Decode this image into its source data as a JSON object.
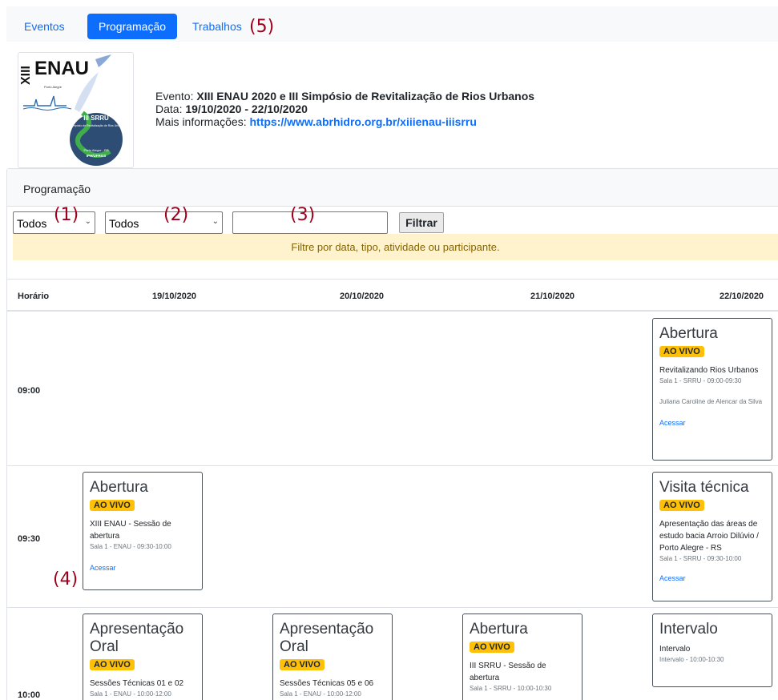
{
  "tabs": [
    {
      "label": "Eventos"
    },
    {
      "label": "Programação"
    },
    {
      "label": "Trabalhos"
    }
  ],
  "annotations": [
    "(1)",
    "(2)",
    "(3)",
    "(4)",
    "(5)"
  ],
  "event": {
    "name_label": "Evento:",
    "name": "XIII ENAU 2020 e III Simpósio de Revitalização de Rios Urbanos",
    "date_label": "Data:",
    "date": "19/10/2020 - 22/10/2020",
    "info_label": "Mais informações:",
    "info_link": "https://www.abrhidro.org.br/xiiienau-iiisrru",
    "logo_text": {
      "main": "ENAU",
      "roman": "XIII",
      "city": "Porto Alegre",
      "badge": "III SRRU",
      "badge_sub": "III Simpósio de Revitalização de Rios Urbanos",
      "place": "Porto Alegre - RS",
      "inst": "IPH/UFRGS"
    }
  },
  "programacao": {
    "header": "Programação",
    "filter_date": "Todos",
    "filter_type": "Todos",
    "search_value": "",
    "filter_button": "Filtrar",
    "hint": "Filtre por data, tipo, atividade ou participante."
  },
  "table": {
    "columns": [
      "Horário",
      "19/10/2020",
      "20/10/2020",
      "21/10/2020",
      "22/10/2020"
    ],
    "times": [
      "09:00",
      "09:30",
      "10:00"
    ],
    "live_badge": "AO VIVO",
    "access_label": "Acessar",
    "events": [
      {
        "title": "Abertura",
        "activity": "Revitalizando Rios Urbanos",
        "meta": "Sala 1 - SRRU - 09:00-09:30",
        "participant": "Juliana Caroline de Alencar da Silva"
      },
      {
        "title": "Abertura",
        "activity": "XIII ENAU - Sessão de abertura",
        "meta": "Sala 1 - ENAU - 09:30-10:00"
      },
      {
        "title": "Visita técnica",
        "activity": "Apresentação das áreas de estudo bacia Arroio Dilúvio / Porto Alegre - RS",
        "meta": "Sala 1 - SRRU - 09:30-10:00"
      },
      {
        "title": "Apresentação Oral",
        "activity": "Sessões Técnicas 01 e 02",
        "meta": "Sala 1 - ENAU - 10:00-12:00"
      },
      {
        "title": "Apresentação Oral",
        "activity": "Sessões Técnicas 05 e 06",
        "meta": "Sala 1 - ENAU - 10:00-12:00"
      },
      {
        "title": "Abertura",
        "activity": "III SRRU - Sessão de abertura",
        "meta": "Sala 1 - SRRU - 10:00-10:30"
      },
      {
        "title": "Intervalo",
        "activity": "Intervalo",
        "meta": "Intervalo - 10:00-10:30"
      }
    ]
  },
  "colors": {
    "primary": "#0d6efd",
    "badge": "#ffc107",
    "hint_bg": "#fff3cd",
    "annotation": "#a0001c"
  }
}
